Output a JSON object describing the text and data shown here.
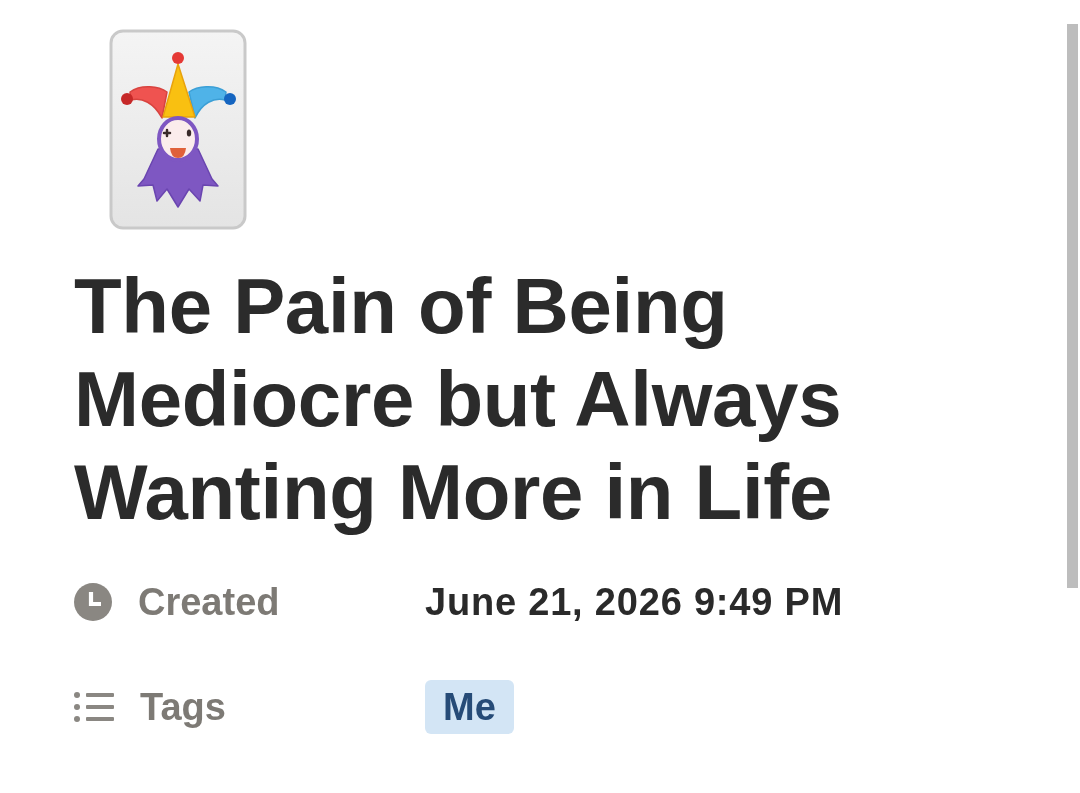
{
  "page": {
    "title": "The Pain of Being Mediocre but Always Wanting More in Life"
  },
  "properties": [
    {
      "kind": "date",
      "label": "Created",
      "value": "June 21, 2026 9:49 PM"
    },
    {
      "kind": "tags",
      "label": "Tags",
      "tags": [
        {
          "label": "Me",
          "color": "#d3e5f5"
        }
      ]
    }
  ]
}
